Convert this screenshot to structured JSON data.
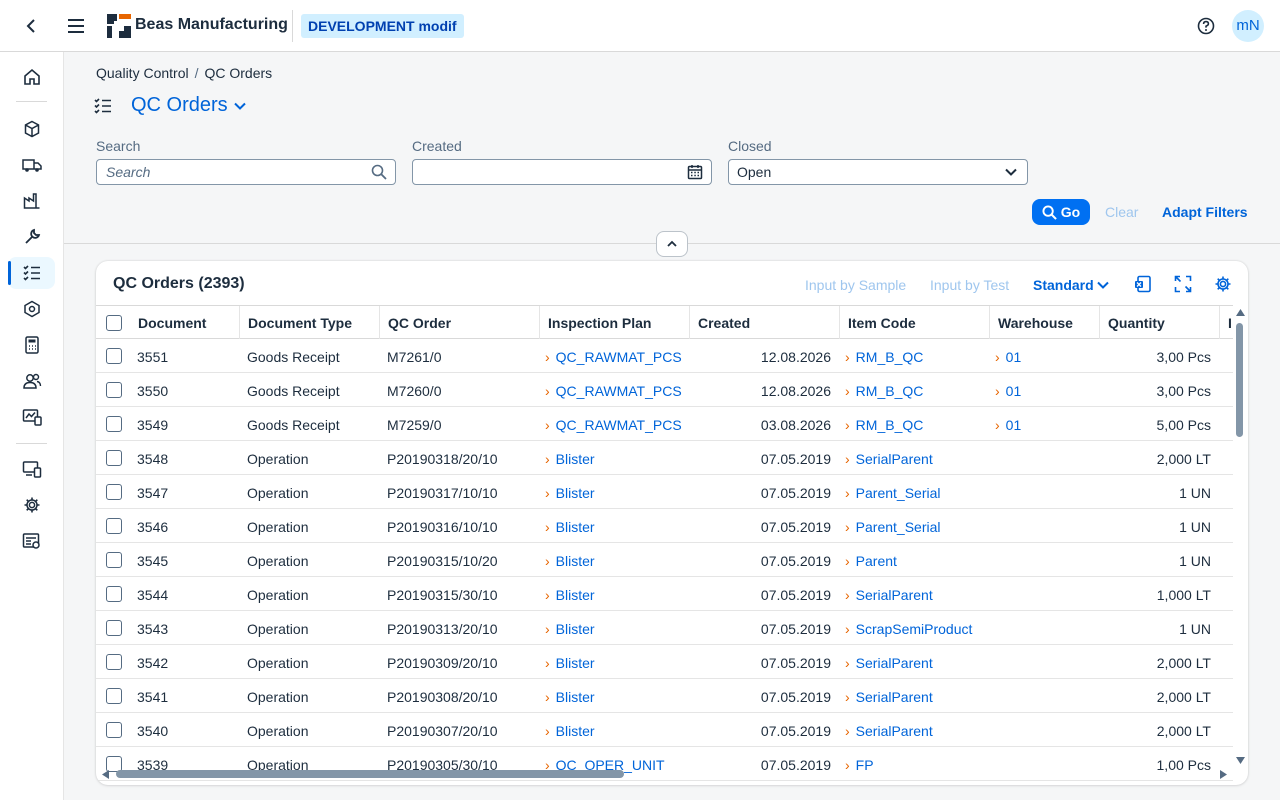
{
  "shell": {
    "brand": "Beas Manufacturing",
    "environment": "DEVELOPMENT modif",
    "avatar_initials": "mN"
  },
  "sidenav": {
    "items": [
      "home",
      "products",
      "shipping",
      "factory",
      "tools",
      "quality-control",
      "packages",
      "calculator",
      "users",
      "monitoring",
      "devices",
      "settings",
      "reports"
    ],
    "active": "quality-control"
  },
  "breadcrumb": {
    "parent": "Quality Control",
    "current": "QC Orders"
  },
  "page_title": "QC Orders",
  "filters": {
    "search_label": "Search",
    "search_placeholder": "Search",
    "created_label": "Created",
    "created_value": "",
    "closed_label": "Closed",
    "closed_value": "Open"
  },
  "actions": {
    "go": "Go",
    "clear": "Clear",
    "adapt": "Adapt Filters"
  },
  "table": {
    "title": "QC Orders (2393)",
    "input_by_sample": "Input by Sample",
    "input_by_test": "Input by Test",
    "variant": "Standard",
    "columns": [
      "Document",
      "Document Type",
      "QC Order",
      "Inspection Plan",
      "Created",
      "Item Code",
      "Warehouse",
      "Quantity",
      "I"
    ],
    "rows": [
      {
        "doc": "3551",
        "type": "Goods Receipt",
        "qc": "M7261/0",
        "plan": "QC_RAWMAT_PCS",
        "created": "12.08.2026",
        "item": "RM_B_QC",
        "wh": "01",
        "qty": "3,00 Pcs"
      },
      {
        "doc": "3550",
        "type": "Goods Receipt",
        "qc": "M7260/0",
        "plan": "QC_RAWMAT_PCS",
        "created": "12.08.2026",
        "item": "RM_B_QC",
        "wh": "01",
        "qty": "3,00 Pcs"
      },
      {
        "doc": "3549",
        "type": "Goods Receipt",
        "qc": "M7259/0",
        "plan": "QC_RAWMAT_PCS",
        "created": "03.08.2026",
        "item": "RM_B_QC",
        "wh": "01",
        "qty": "5,00 Pcs"
      },
      {
        "doc": "3548",
        "type": "Operation",
        "qc": "P20190318/20/10",
        "plan": "Blister",
        "created": "07.05.2019",
        "item": "SerialParent",
        "wh": "",
        "qty": "2,000 LT"
      },
      {
        "doc": "3547",
        "type": "Operation",
        "qc": "P20190317/10/10",
        "plan": "Blister",
        "created": "07.05.2019",
        "item": "Parent_Serial",
        "wh": "",
        "qty": "1 UN"
      },
      {
        "doc": "3546",
        "type": "Operation",
        "qc": "P20190316/10/10",
        "plan": "Blister",
        "created": "07.05.2019",
        "item": "Parent_Serial",
        "wh": "",
        "qty": "1 UN"
      },
      {
        "doc": "3545",
        "type": "Operation",
        "qc": "P20190315/10/20",
        "plan": "Blister",
        "created": "07.05.2019",
        "item": "Parent",
        "wh": "",
        "qty": "1 UN"
      },
      {
        "doc": "3544",
        "type": "Operation",
        "qc": "P20190315/30/10",
        "plan": "Blister",
        "created": "07.05.2019",
        "item": "SerialParent",
        "wh": "",
        "qty": "1,000 LT"
      },
      {
        "doc": "3543",
        "type": "Operation",
        "qc": "P20190313/20/10",
        "plan": "Blister",
        "created": "07.05.2019",
        "item": "ScrapSemiProduct",
        "wh": "",
        "qty": "1 UN"
      },
      {
        "doc": "3542",
        "type": "Operation",
        "qc": "P20190309/20/10",
        "plan": "Blister",
        "created": "07.05.2019",
        "item": "SerialParent",
        "wh": "",
        "qty": "2,000 LT"
      },
      {
        "doc": "3541",
        "type": "Operation",
        "qc": "P20190308/20/10",
        "plan": "Blister",
        "created": "07.05.2019",
        "item": "SerialParent",
        "wh": "",
        "qty": "2,000 LT"
      },
      {
        "doc": "3540",
        "type": "Operation",
        "qc": "P20190307/20/10",
        "plan": "Blister",
        "created": "07.05.2019",
        "item": "SerialParent",
        "wh": "",
        "qty": "2,000 LT"
      },
      {
        "doc": "3539",
        "type": "Operation",
        "qc": "P20190305/30/10",
        "plan": "QC_OPER_UNIT",
        "created": "07.05.2019",
        "item": "FP",
        "wh": "",
        "qty": "1,00 Pcs"
      }
    ]
  },
  "colors": {
    "accent": "#0064d9",
    "go_button": "#0070f2",
    "link_arrow": "#e76500"
  }
}
